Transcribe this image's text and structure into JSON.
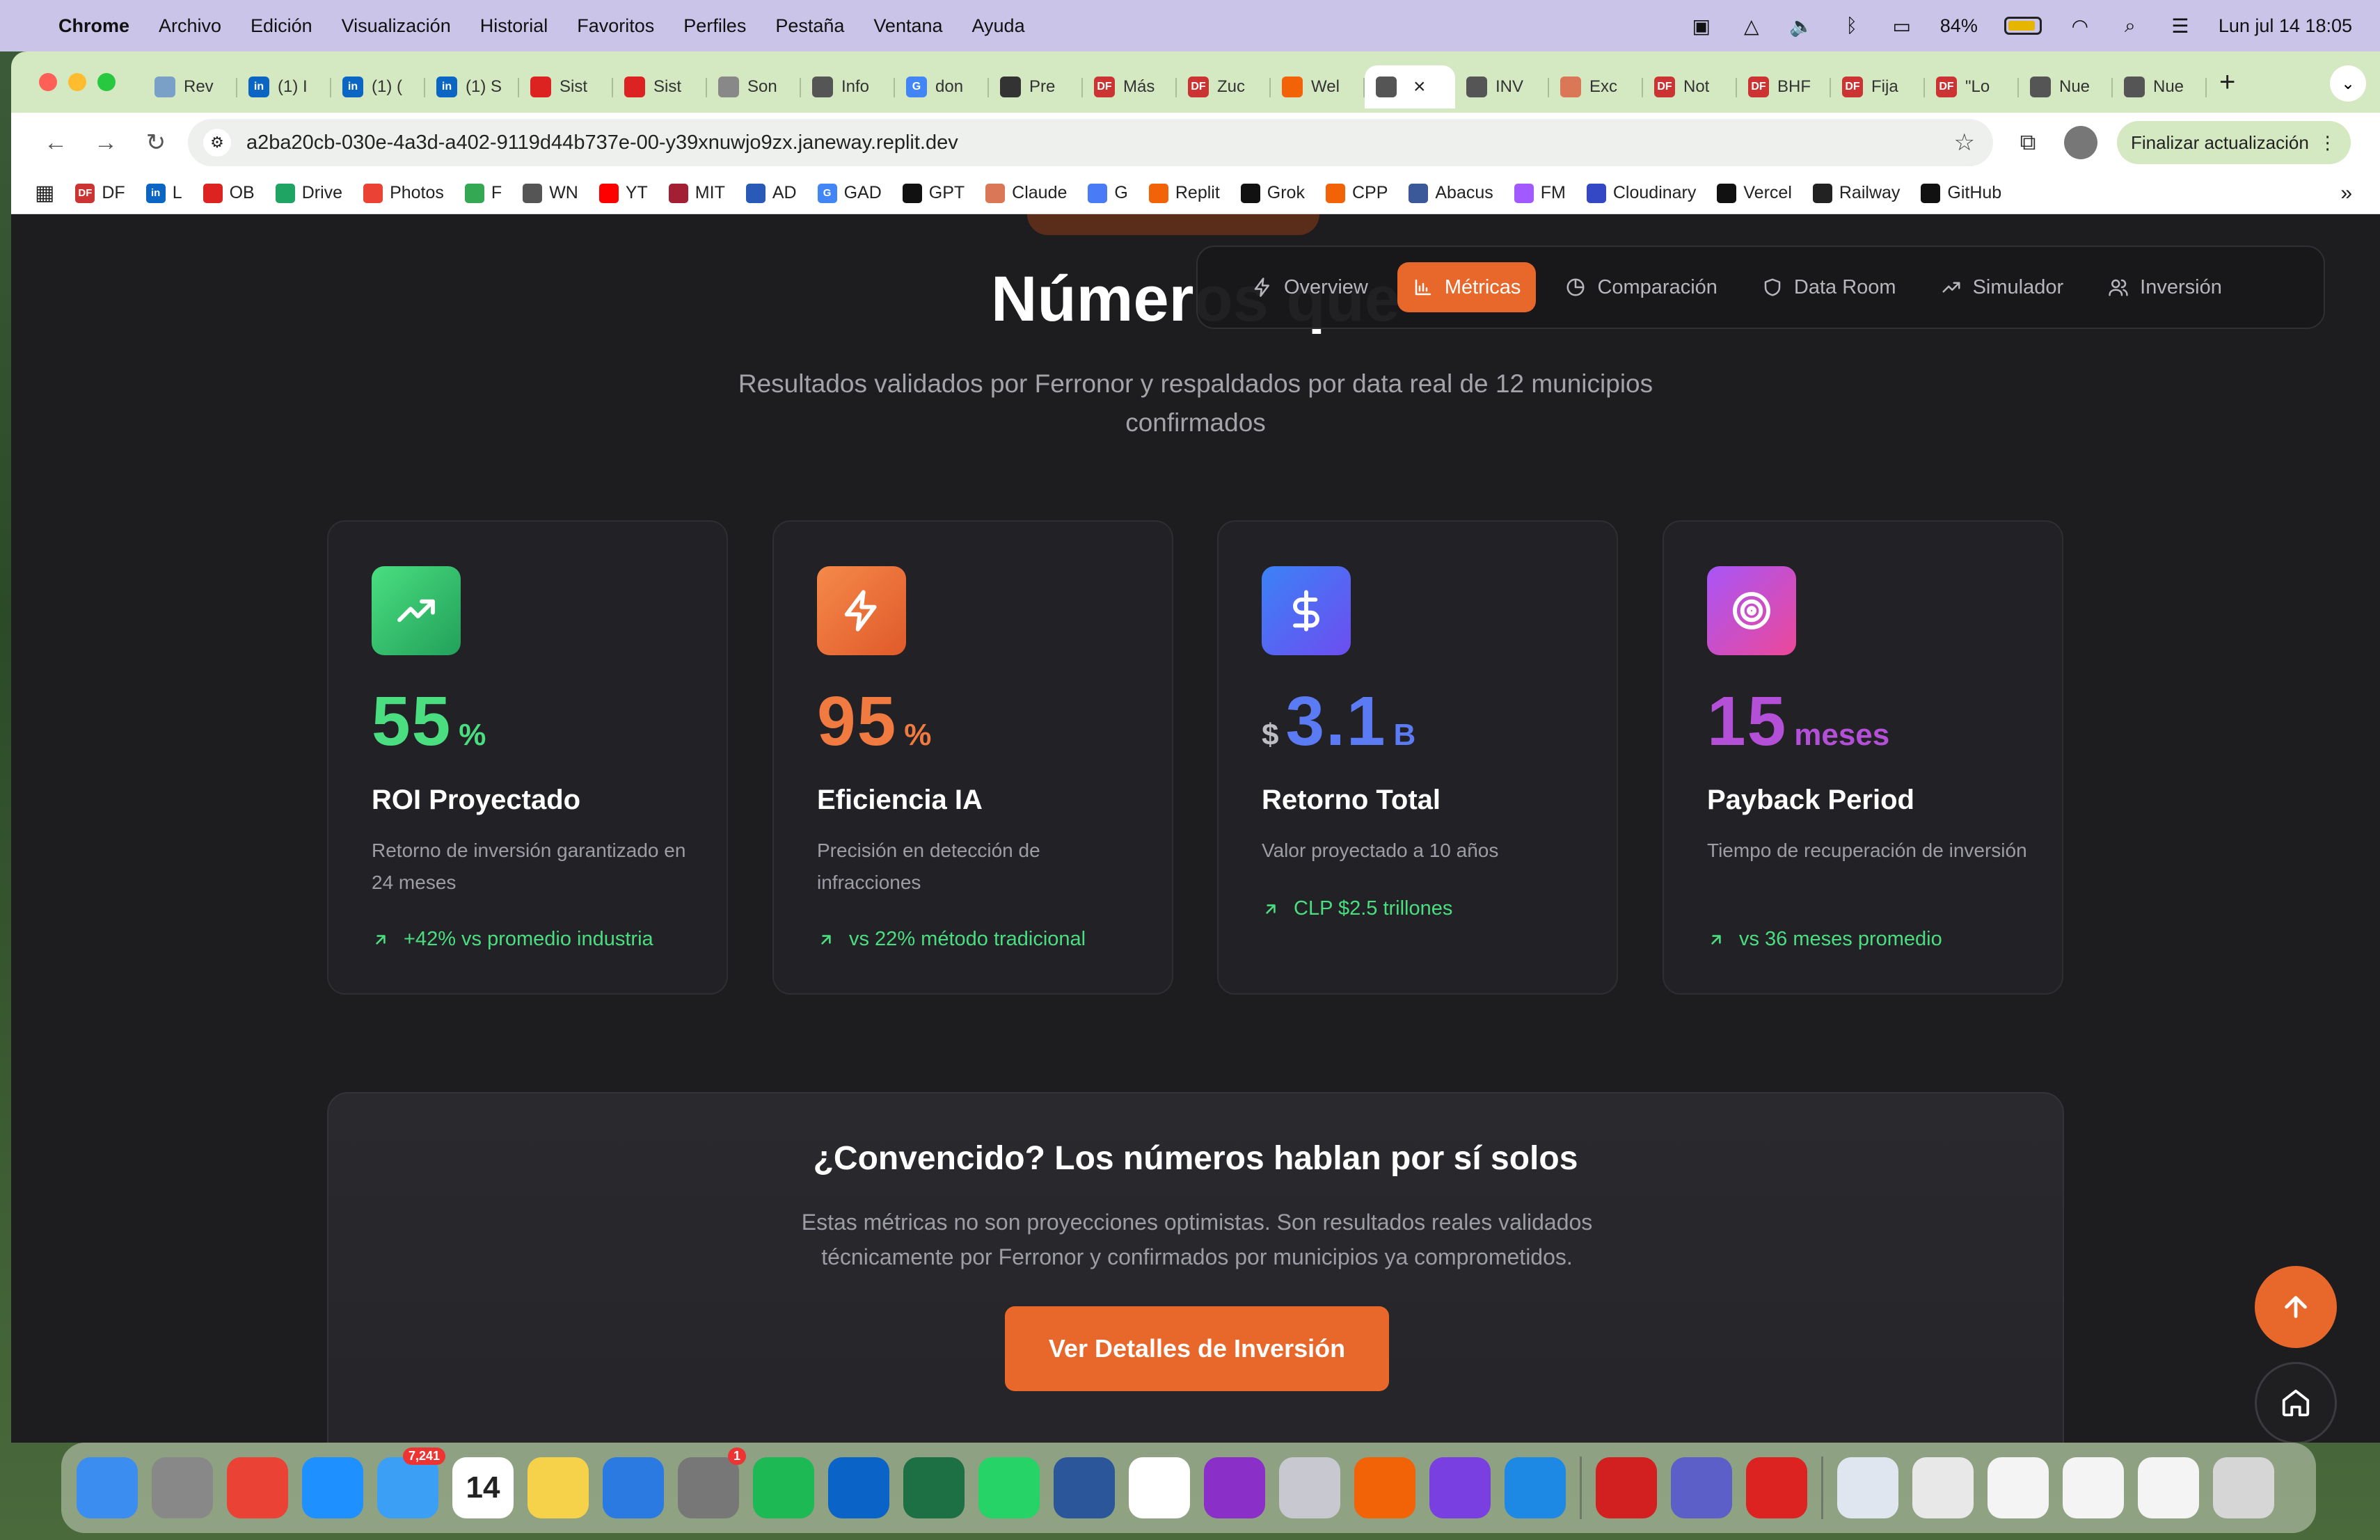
{
  "menubar": {
    "app": "Chrome",
    "items": [
      "Archivo",
      "Edición",
      "Visualización",
      "Historial",
      "Favoritos",
      "Perfiles",
      "Pestaña",
      "Ventana",
      "Ayuda"
    ],
    "battery": "84%",
    "datetime": "Lun jul 14  18:05"
  },
  "tabs": [
    {
      "label": "Rev",
      "color": "#7aa0c8"
    },
    {
      "label": "(1) I",
      "color": "#0a66c2",
      "icon": "in"
    },
    {
      "label": "(1) (",
      "color": "#0a66c2",
      "icon": "in"
    },
    {
      "label": "(1) S",
      "color": "#0a66c2",
      "icon": "in"
    },
    {
      "label": "Sist",
      "color": "#d22"
    },
    {
      "label": "Sist",
      "color": "#d22"
    },
    {
      "label": "Son",
      "color": "#888"
    },
    {
      "label": "Info",
      "color": "#555"
    },
    {
      "label": "don",
      "color": "#4285f4",
      "icon": "G"
    },
    {
      "label": "Pre",
      "color": "#333"
    },
    {
      "label": "Más",
      "color": "#c33",
      "icon": "DF"
    },
    {
      "label": "Zuc",
      "color": "#c33",
      "icon": "DF"
    },
    {
      "label": "Wel",
      "color": "#f26207"
    },
    {
      "label": "",
      "color": "#555",
      "active": true
    },
    {
      "label": "INV",
      "color": "#555"
    },
    {
      "label": "Exc",
      "color": "#d97757"
    },
    {
      "label": "Not",
      "color": "#c33",
      "icon": "DF"
    },
    {
      "label": "BHF",
      "color": "#c33",
      "icon": "DF"
    },
    {
      "label": "Fija",
      "color": "#c33",
      "icon": "DF"
    },
    {
      "label": "\"Lo",
      "color": "#c33",
      "icon": "DF"
    },
    {
      "label": "Nue",
      "color": "#555"
    },
    {
      "label": "Nue",
      "color": "#555"
    }
  ],
  "url": "a2ba20cb-030e-4a3d-a402-9119d44b737e-00-y39xnuwjo9zx.janeway.replit.dev",
  "update_label": "Finalizar actualización",
  "bookmarks": [
    {
      "label": "DF",
      "color": "#c33",
      "icon": "DF"
    },
    {
      "label": "L",
      "color": "#0a66c2",
      "icon": "in"
    },
    {
      "label": "OB",
      "color": "#d22"
    },
    {
      "label": "Drive",
      "color": "#1fa463"
    },
    {
      "label": "Photos",
      "color": "#ea4335"
    },
    {
      "label": "F",
      "color": "#34a853"
    },
    {
      "label": "WN",
      "color": "#555"
    },
    {
      "label": "YT",
      "color": "#f00"
    },
    {
      "label": "MIT",
      "color": "#a31f34"
    },
    {
      "label": "AD",
      "color": "#2a5ab8"
    },
    {
      "label": "GAD",
      "color": "#4285f4",
      "icon": "G"
    },
    {
      "label": "GPT",
      "color": "#111"
    },
    {
      "label": "Claude",
      "color": "#d97757"
    },
    {
      "label": "G",
      "color": "#4a7bf7"
    },
    {
      "label": "Replit",
      "color": "#f26207"
    },
    {
      "label": "Grok",
      "color": "#111"
    },
    {
      "label": "CPP",
      "color": "#f26207"
    },
    {
      "label": "Abacus",
      "color": "#3b5998"
    },
    {
      "label": "FM",
      "color": "#a259ff"
    },
    {
      "label": "Cloudinary",
      "color": "#3448c5"
    },
    {
      "label": "Vercel",
      "color": "#111"
    },
    {
      "label": "Railway",
      "color": "#222"
    },
    {
      "label": "GitHub",
      "color": "#111"
    }
  ],
  "page": {
    "title": "Números que ",
    "subtitle": "Resultados validados por Ferronor y respaldados por data real de 12 municipios confirmados",
    "nav": [
      {
        "label": "Overview",
        "icon": "zap-icon"
      },
      {
        "label": "Métricas",
        "icon": "bar-chart-icon",
        "active": true
      },
      {
        "label": "Comparación",
        "icon": "pie-chart-icon"
      },
      {
        "label": "Data Room",
        "icon": "shield-icon"
      },
      {
        "label": "Simulador",
        "icon": "trending-up-icon"
      },
      {
        "label": "Inversión",
        "icon": "users-icon"
      }
    ],
    "cards": [
      {
        "prefix": "",
        "value": "55",
        "unit": "%",
        "title": "ROI Proyectado",
        "desc": "Retorno de inversión garantizado en 24 meses",
        "trend": "+42% vs promedio industria",
        "icon": "trending-up-icon",
        "grad": [
          "#4ade80",
          "#22a05a"
        ],
        "valcolor": "#4ade80"
      },
      {
        "prefix": "",
        "value": "95",
        "unit": "%",
        "title": "Eficiencia IA",
        "desc": "Precisión en detección de infracciones",
        "trend": "vs 22% método tradicional",
        "icon": "zap-icon",
        "grad": [
          "#f5894a",
          "#e05a2a"
        ],
        "valcolor": "#f07a40"
      },
      {
        "prefix": "$",
        "value": "3.1",
        "unit": "B",
        "title": "Retorno Total",
        "desc": "Valor proyectado a 10 años",
        "trend": "CLP $2.5 trillones",
        "icon": "dollar-icon",
        "grad": [
          "#3b82f6",
          "#6d4df0"
        ],
        "valcolor": "#5b7bf5"
      },
      {
        "prefix": "",
        "value": "15",
        "unit": "meses",
        "title": "Payback Period",
        "desc": "Tiempo de recuperación de inversión",
        "trend": "vs 36 meses promedio",
        "icon": "target-icon",
        "grad": [
          "#a855f7",
          "#ec4899"
        ],
        "valcolor": "#b44fd8"
      }
    ],
    "cta": {
      "title": "¿Convencido? Los números hablan por sí solos",
      "desc": "Estas métricas no son proyecciones optimistas. Son resultados reales validados técnicamente por Ferronor y confirmados por municipios ya comprometidos.",
      "button": "Ver Detalles de Inversión"
    }
  },
  "dock": [
    {
      "name": "finder",
      "color": "#3b8ef0"
    },
    {
      "name": "launchpad",
      "color": "#888"
    },
    {
      "name": "chrome",
      "color": "#ea4335"
    },
    {
      "name": "safari",
      "color": "#1e90ff"
    },
    {
      "name": "mail",
      "color": "#3a9ff5",
      "badge": "7,241"
    },
    {
      "name": "calendar",
      "color": "#fff",
      "label": "14"
    },
    {
      "name": "notes",
      "color": "#f5d24a"
    },
    {
      "name": "keynote",
      "color": "#2a7ae2"
    },
    {
      "name": "settings",
      "color": "#777",
      "badge": "1"
    },
    {
      "name": "spotify",
      "color": "#1db954"
    },
    {
      "name": "outlook",
      "color": "#0a64c8"
    },
    {
      "name": "excel",
      "color": "#1d7044"
    },
    {
      "name": "whatsapp",
      "color": "#25d366"
    },
    {
      "name": "word",
      "color": "#2b579a"
    },
    {
      "name": "fantastical",
      "color": "#fff"
    },
    {
      "name": "app-purple",
      "color": "#8b2fc9"
    },
    {
      "name": "preview",
      "color": "#c8c8d0"
    },
    {
      "name": "app-orange",
      "color": "#f26207"
    },
    {
      "name": "github-desktop",
      "color": "#7a3fe0"
    },
    {
      "name": "vscode",
      "color": "#1e88e5"
    },
    {
      "name": "acrobat",
      "color": "#d21f1f"
    },
    {
      "name": "teams",
      "color": "#5b5fc7"
    },
    {
      "name": "photobooth",
      "color": "#d22"
    },
    {
      "name": "downloads",
      "color": "#dfe6ef"
    },
    {
      "name": "window-1",
      "color": "#e8e8e8"
    },
    {
      "name": "window-2",
      "color": "#f4f4f4"
    },
    {
      "name": "window-3",
      "color": "#f4f4f4"
    },
    {
      "name": "window-4",
      "color": "#f4f4f4"
    },
    {
      "name": "trash",
      "color": "#d6d6d6"
    }
  ]
}
